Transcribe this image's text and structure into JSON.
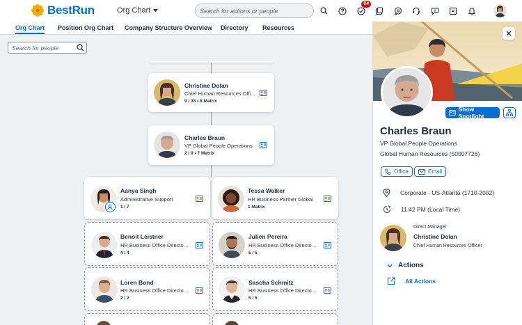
{
  "shell": {
    "brand": "BestRun",
    "app_title": "Org Chart",
    "search_placeholder": "Search for actions or people",
    "notification_count": "84",
    "icons": [
      "search-icon",
      "help-icon",
      "tasks-icon",
      "inbox-icon",
      "chat-icon",
      "support-icon",
      "feedback-icon",
      "notes-icon",
      "bell-icon"
    ]
  },
  "tabs": [
    "Org Chart",
    "Position Org Chart",
    "Company Structure Overview",
    "Directory",
    "Resources"
  ],
  "canvas": {
    "search_placeholder": "Search for people",
    "cards": [
      {
        "name": "Christine Dolan",
        "title": "Chief Human Resources Offi...",
        "counts": "9 / 33  •  8 Matrix"
      },
      {
        "name": "Charles Braun",
        "title": "VP Global People Operations",
        "counts": "2 / 9  •  7 Matrix"
      },
      {
        "name": "Aanya Singh",
        "title": "Administrative Support",
        "counts": "1 / 7"
      },
      {
        "name": "Tessa Walker",
        "title": "HR Business Partner Global",
        "counts": "1 Matrix"
      },
      {
        "name": "Benoit Leistner",
        "title": "HR Business Office Director ...",
        "counts": "4 / 4"
      },
      {
        "name": "Julien Pereira",
        "title": "HR Business Office Director ...",
        "counts": "5 / 5"
      },
      {
        "name": "Loren Bond",
        "title": "HR Business Office Director ...",
        "counts": "2 / 2"
      },
      {
        "name": "Sascha Schmitz",
        "title": "HR Business Office Director ...",
        "counts": "5 / 5"
      }
    ]
  },
  "panel": {
    "spotlight_label": "Show Spotlight",
    "name": "Charles Braun",
    "title": "VP Global People Operations",
    "department": "Global Human Resources (50007726)",
    "office_label": "Office",
    "email_label": "Email",
    "location": "Corporate - US-Atlanta (1710-2002)",
    "local_time": "11:42 PM (Local Time)",
    "manager_label": "Direct Manager",
    "manager_name": "Christine Dolan",
    "manager_title": "Chief Human Resources Officer",
    "actions_label": "Actions",
    "all_actions_label": "All Actions"
  },
  "colors": {
    "accent": "#0a6ed1",
    "badge": "#d20a0a",
    "logo_flower": "#f0ab00"
  }
}
